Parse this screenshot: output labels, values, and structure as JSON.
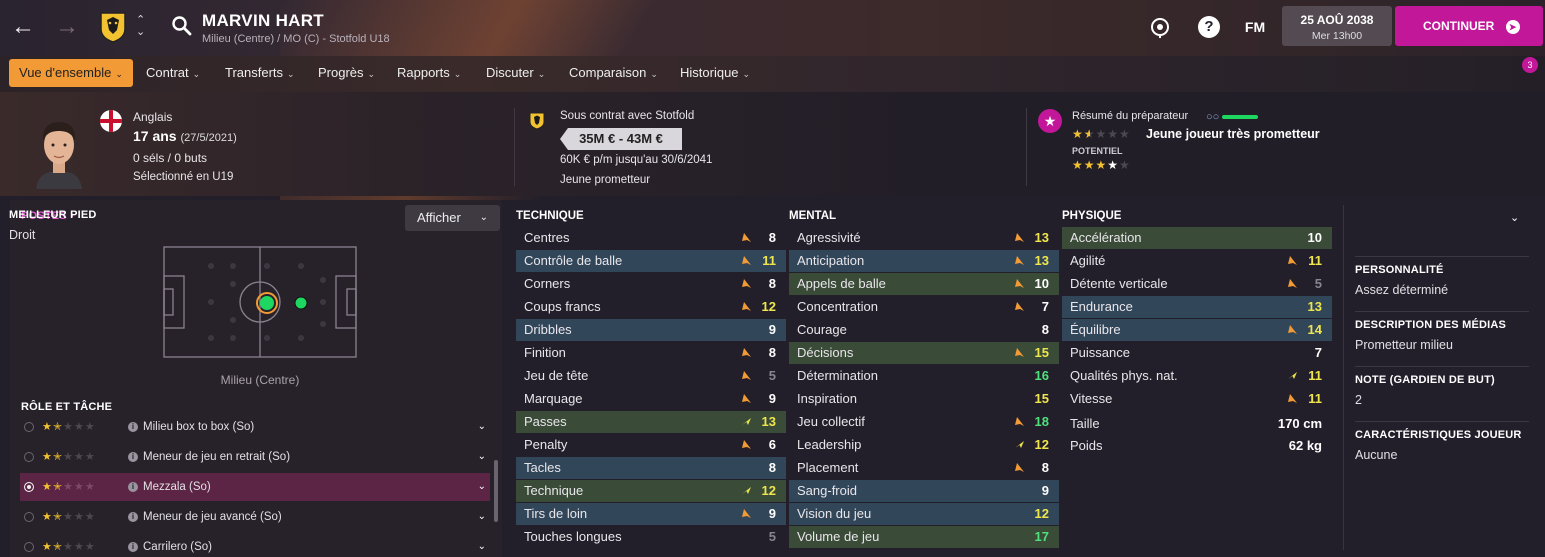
{
  "header": {
    "player_name": "MARVIN HART",
    "subtitle": "Milieu (Centre) / MO (C) - Stotfold U18",
    "fm_label": "FM",
    "date": "25 AOÛ 2038",
    "time": "Mer 13h00",
    "continue_label": "CONTINUER"
  },
  "menu": {
    "items": [
      {
        "label": "Vue d'ensemble"
      },
      {
        "label": "Contrat"
      },
      {
        "label": "Transferts"
      },
      {
        "label": "Progrès"
      },
      {
        "label": "Rapports"
      },
      {
        "label": "Discuter"
      },
      {
        "label": "Comparaison"
      },
      {
        "label": "Historique"
      }
    ],
    "notification_count": "3"
  },
  "info": {
    "nationality": "Anglais",
    "age": "17 ans",
    "dob": "(27/5/2021)",
    "caps": "0 séls / 0 buts",
    "selection": "Sélectionné en U19",
    "contract_club": "Sous contrat avec Stotfold",
    "value": "35M € - 43M €",
    "wage": "60K € p/m jusqu'au 30/6/2041",
    "status": "Jeune prometteur",
    "coach_title": "Résumé du préparateur",
    "coach_verdict": "Jeune joueur très prometteur",
    "potential_label": "POTENTIEL",
    "current_stars": 1.5,
    "potential_stars": 3.5
  },
  "positions": {
    "title": "POSTES",
    "afficher_label": "Afficher",
    "position_label": "Milieu (Centre)"
  },
  "roles": {
    "title": "RÔLE ET TÂCHE",
    "items": [
      {
        "name": "Milieu box to box (So)",
        "stars": 1.5
      },
      {
        "name": "Meneur de jeu en retrait (So)",
        "stars": 1.5
      },
      {
        "name": "Mezzala (So)",
        "stars": 1.5
      },
      {
        "name": "Meneur de jeu avancé (So)",
        "stars": 1.5
      },
      {
        "name": "Carrilero (So)",
        "stars": 1.5
      }
    ]
  },
  "technique": {
    "title": "TECHNIQUE",
    "attributes": [
      {
        "name": "Centres",
        "value": "8"
      },
      {
        "name": "Contrôle de balle",
        "value": "11"
      },
      {
        "name": "Corners",
        "value": "8"
      },
      {
        "name": "Coups francs",
        "value": "12"
      },
      {
        "name": "Dribbles",
        "value": "9"
      },
      {
        "name": "Finition",
        "value": "8"
      },
      {
        "name": "Jeu de tête",
        "value": "5"
      },
      {
        "name": "Marquage",
        "value": "9"
      },
      {
        "name": "Passes",
        "value": "13"
      },
      {
        "name": "Penalty",
        "value": "6"
      },
      {
        "name": "Tacles",
        "value": "8"
      },
      {
        "name": "Technique",
        "value": "12"
      },
      {
        "name": "Tirs de loin",
        "value": "9"
      },
      {
        "name": "Touches longues",
        "value": "5"
      }
    ]
  },
  "mental": {
    "title": "MENTAL",
    "attributes": [
      {
        "name": "Agressivité",
        "value": "13"
      },
      {
        "name": "Anticipation",
        "value": "13"
      },
      {
        "name": "Appels de balle",
        "value": "10"
      },
      {
        "name": "Concentration",
        "value": "7"
      },
      {
        "name": "Courage",
        "value": "8"
      },
      {
        "name": "Décisions",
        "value": "15"
      },
      {
        "name": "Détermination",
        "value": "16"
      },
      {
        "name": "Inspiration",
        "value": "15"
      },
      {
        "name": "Jeu collectif",
        "value": "18"
      },
      {
        "name": "Leadership",
        "value": "12"
      },
      {
        "name": "Placement",
        "value": "8"
      },
      {
        "name": "Sang-froid",
        "value": "9"
      },
      {
        "name": "Vision du jeu",
        "value": "12"
      },
      {
        "name": "Volume de jeu",
        "value": "17"
      }
    ]
  },
  "physique": {
    "title": "PHYSIQUE",
    "attributes": [
      {
        "name": "Accélération",
        "value": "10"
      },
      {
        "name": "Agilité",
        "value": "11"
      },
      {
        "name": "Détente verticale",
        "value": "5"
      },
      {
        "name": "Endurance",
        "value": "13"
      },
      {
        "name": "Équilibre",
        "value": "14"
      },
      {
        "name": "Puissance",
        "value": "7"
      },
      {
        "name": "Qualités phys. nat.",
        "value": "11"
      },
      {
        "name": "Vitesse",
        "value": "11"
      }
    ],
    "height_label": "Taille",
    "height": "170 cm",
    "weight_label": "Poids",
    "weight": "62 kg"
  },
  "sidebar": {
    "foot_title": "MEILLEUR PIED",
    "foot": "Droit",
    "personality_title": "PERSONNALITÉ",
    "personality": "Assez déterminé",
    "media_title": "DESCRIPTION DES MÉDIAS",
    "media": "Prometteur milieu",
    "gk_title": "NOTE (GARDIEN DE BUT)",
    "gk": "2",
    "traits_title": "CARACTÉRISTIQUES JOUEUR",
    "traits": "Aucune"
  },
  "colors": {
    "accent_orange": "#f19a36",
    "accent_magenta": "#c3179a",
    "highlight_blue": "#32465a",
    "highlight_green": "#3a4b38",
    "value_yellow": "#efe64d",
    "value_green": "#4ee07a"
  }
}
